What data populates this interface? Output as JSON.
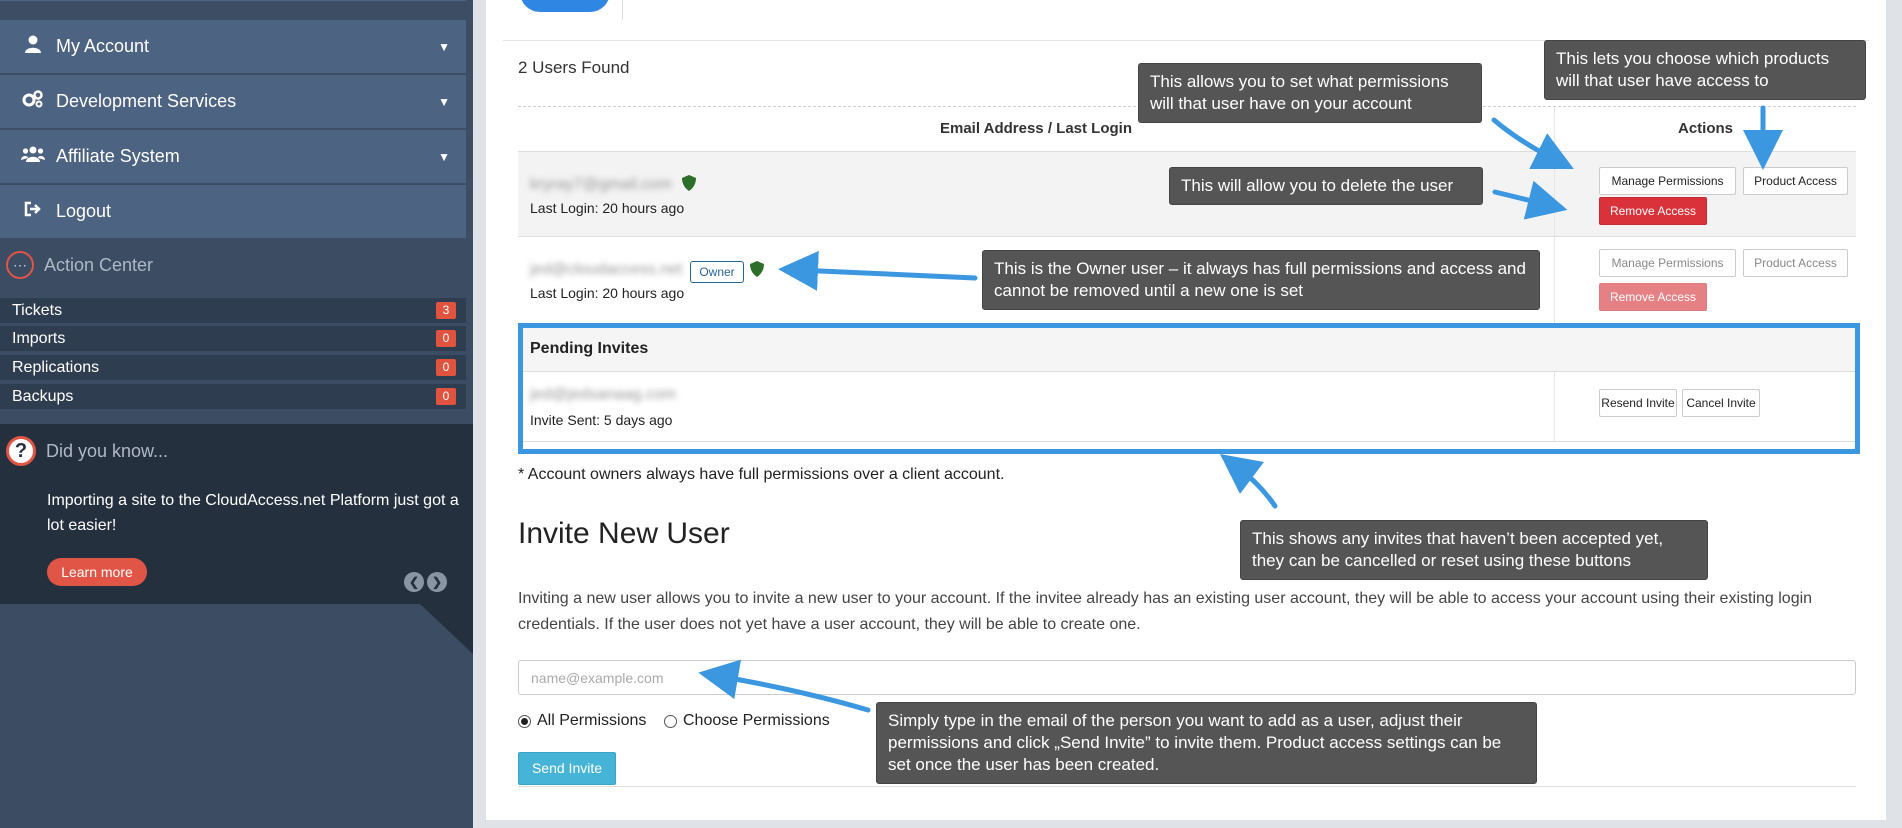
{
  "sidebar": {
    "nav": [
      {
        "label": "My Account",
        "icon": "user-icon"
      },
      {
        "label": "Development Services",
        "icon": "gears-icon"
      },
      {
        "label": "Affiliate System",
        "icon": "users-icon"
      },
      {
        "label": "Logout",
        "icon": "logout-icon"
      }
    ],
    "action_center": {
      "title": "Action Center",
      "items": [
        {
          "label": "Tickets",
          "count": "3"
        },
        {
          "label": "Imports",
          "count": "0"
        },
        {
          "label": "Replications",
          "count": "0"
        },
        {
          "label": "Backups",
          "count": "0"
        }
      ]
    },
    "did_you_know": {
      "title": "Did you know...",
      "text": "Importing a site to the CloudAccess.net Platform just got a lot easier!",
      "button": "Learn more"
    }
  },
  "main": {
    "users_found": "2 Users Found",
    "table": {
      "col_email": "Email Address / Last Login",
      "col_actions": "Actions"
    },
    "users": [
      {
        "email": "kryray7@gmail.com",
        "last_login": "Last Login: 20 hours ago",
        "owner": false
      },
      {
        "email": "jed@cloudaccess.net",
        "last_login": "Last Login: 20 hours ago",
        "owner": true,
        "owner_label": "Owner"
      }
    ],
    "buttons": {
      "manage_permissions": "Manage Permissions",
      "product_access": "Product Access",
      "remove_access": "Remove Access",
      "resend_invite": "Resend Invite",
      "cancel_invite": "Cancel Invite"
    },
    "pending": {
      "title": "Pending Invites",
      "email": "jed@jedsanaag.com",
      "sent": "Invite Sent: 5 days ago"
    },
    "note": "* Account owners always have full permissions over a client account.",
    "invite": {
      "title": "Invite New User",
      "description": "Inviting a new user allows you to invite a new user to your account. If the invitee already has an existing user account, they will be able to access your account using their existing login credentials. If the user does not yet have a user account, they will be able to create one.",
      "placeholder": "name@example.com",
      "radio_all": "All Permissions",
      "radio_choose": "Choose Permissions",
      "selected": "All Permissions",
      "send_button": "Send Invite"
    }
  },
  "callouts": {
    "permissions": "This allows you to set what permissions will that user have on your account",
    "products": "This lets you choose which products will that user have access to",
    "delete": "This will allow you to delete the user",
    "owner": "This is the Owner user – it always has full permissions and access and cannot be removed until a new one is set",
    "invites": "This shows any invites that haven’t been accepted yet, they can be cancelled or reset using these buttons",
    "send": "Simply type in the email of the person you want to add as a user, adjust their permissions and click „Send Invite” to invite them. Product access settings can be set once the user has been created."
  },
  "colors": {
    "sidebar": "#4d6382",
    "accent": "#2f87e3",
    "danger": "#d9323b",
    "callout_bg": "#555555",
    "arrow": "#3a97e0",
    "send_button": "#46b4d6"
  }
}
